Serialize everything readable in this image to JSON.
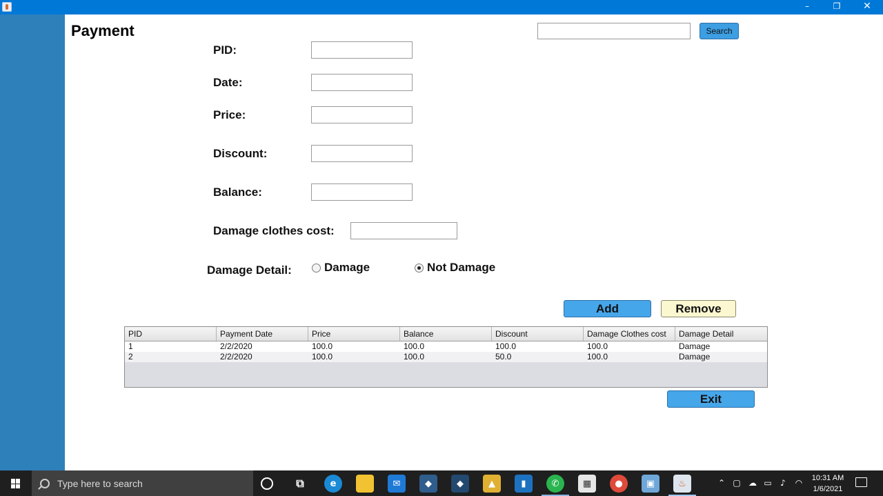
{
  "window": {
    "controls": {
      "minimize": "–",
      "maximize": "❐",
      "close": "✕"
    }
  },
  "page": {
    "title": "Payment"
  },
  "search": {
    "value": "",
    "button_label": "Search"
  },
  "form": {
    "pid_label": "PID:",
    "date_label": "Date:",
    "price_label": "Price:",
    "discount_label": "Discount:",
    "balance_label": "Balance:",
    "damage_cost_label": "Damage clothes cost:",
    "damage_detail_label": "Damage Detail:",
    "pid_value": "",
    "date_value": "",
    "price_value": "",
    "discount_value": "",
    "balance_value": "",
    "damage_cost_value": "",
    "damage_option": {
      "label": "Damage",
      "selected": false
    },
    "not_damage_option": {
      "label": "Not Damage",
      "selected": true
    }
  },
  "actions": {
    "add_label": "Add",
    "remove_label": "Remove",
    "exit_label": "Exit"
  },
  "table": {
    "headers": [
      "PID",
      "Payment Date",
      "Price",
      "Balance",
      "Discount",
      "Damage Clothes cost",
      "Damage Detail"
    ],
    "rows": [
      [
        "1",
        "2/2/2020",
        "100.0",
        "100.0",
        "100.0",
        "100.0",
        "Damage"
      ],
      [
        "2",
        "2/2/2020",
        "100.0",
        "100.0",
        "50.0",
        "100.0",
        "Damage"
      ]
    ]
  },
  "taskbar": {
    "search_placeholder": "Type here to search",
    "apps": [
      "task-view",
      "edge",
      "file-explorer",
      "mail",
      "mysql-workbench",
      "visual-studio",
      "python",
      "trello",
      "whatsapp",
      "store",
      "chrome",
      "virtualbox",
      "java"
    ],
    "time": "10:31 AM",
    "date": "1/6/2021"
  },
  "colors": {
    "titlebar": "#0078d7",
    "sidebar": "#2e80bb",
    "accent_button": "#46a6ea",
    "remove_button": "#fbf7d0",
    "taskbar": "#1f1f1f"
  }
}
